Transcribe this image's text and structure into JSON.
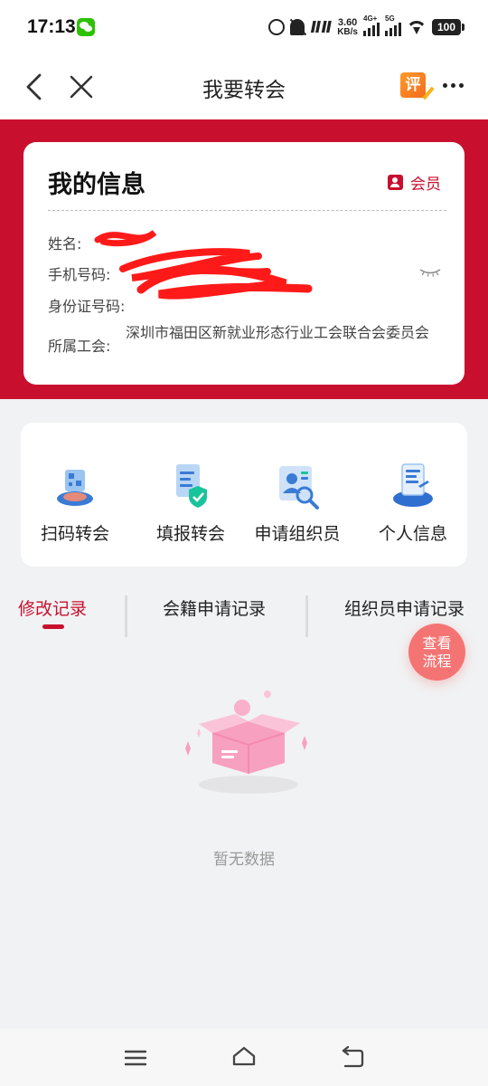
{
  "status_bar": {
    "time": "17:13",
    "net_speed_value": "3.60",
    "net_speed_unit": "KB/s",
    "signal_1_label": "4G+",
    "signal_2_label": "5G",
    "battery": "100"
  },
  "header": {
    "title": "我要转会",
    "review_badge": "评"
  },
  "info_card": {
    "title": "我的信息",
    "member_label": "会员",
    "name_label": "姓名:",
    "phone_label": "手机号码:",
    "id_label": "身份证号码:",
    "union_label": "所属工会:",
    "union_value": "深圳市福田区新就业形态行业工会联合会委员会"
  },
  "functions": [
    {
      "label": "扫码转会",
      "icon": "scan-icon"
    },
    {
      "label": "填报转会",
      "icon": "form-shield-icon"
    },
    {
      "label": "申请组织员",
      "icon": "person-search-icon"
    },
    {
      "label": "个人信息",
      "icon": "profile-document-icon"
    }
  ],
  "tabs": [
    {
      "label": "修改记录",
      "active": true
    },
    {
      "label": "会籍申请记录",
      "active": false
    },
    {
      "label": "组织员申请记录",
      "active": false
    }
  ],
  "float_button": {
    "line1": "查看",
    "line2": "流程"
  },
  "empty_state": {
    "text": "暂无数据"
  },
  "colors": {
    "brand_red": "#c8102e",
    "float_button": "#f47474",
    "page_background": "#f1f2f3"
  }
}
